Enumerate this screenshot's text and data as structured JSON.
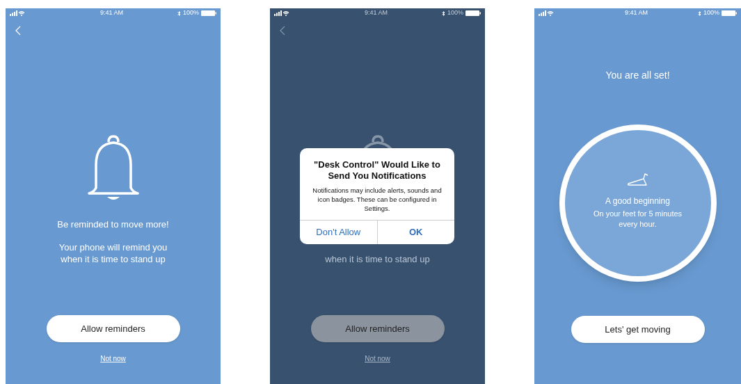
{
  "screens": [
    {
      "kind": "reminder",
      "dimmed": false,
      "status": {
        "time": "9:41 AM",
        "battery": "100%"
      },
      "back": true,
      "title": "Be reminded to move more!",
      "body": [
        "Your phone will remind you",
        "when it is time to stand up"
      ],
      "button": "Allow reminders",
      "link": "Not now"
    },
    {
      "kind": "reminder",
      "dimmed": true,
      "status": {
        "time": "9:41 AM",
        "battery": "100%"
      },
      "back": true,
      "body": [
        "when it is time to stand up"
      ],
      "button": "Allow reminders",
      "link": "Not now",
      "dialog": {
        "title": "\"Desk Control\" Would Like to Send You Notifications",
        "message": "Notifications may include alerts, sounds and icon badges. These can be configured in Settings.",
        "buttons": [
          "Don't Allow",
          "OK"
        ]
      }
    },
    {
      "kind": "done",
      "dimmed": false,
      "status": {
        "time": "9:41 AM",
        "battery": "100%"
      },
      "title": "You are all set!",
      "card": {
        "heading": "A good beginning",
        "text": "On your feet for 5 minutes every hour."
      },
      "button": "Lets' get moving"
    }
  ]
}
